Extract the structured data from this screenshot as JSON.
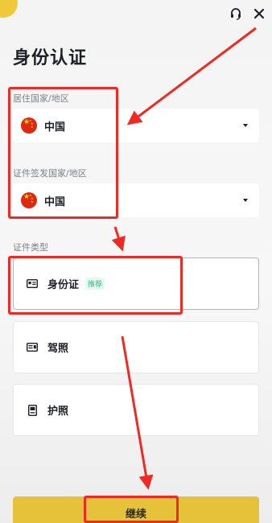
{
  "header": {
    "title": "身份认证",
    "support_icon": "headset-icon",
    "close_icon": "close-icon"
  },
  "residence": {
    "label": "居住国家/地区",
    "value": "中国",
    "flag_icon": "china-flag-icon"
  },
  "issuing": {
    "label": "证件签发国家/地区",
    "value": "中国",
    "flag_icon": "china-flag-icon"
  },
  "document_type": {
    "label": "证件类型",
    "options": [
      {
        "label": "身份证",
        "badge": "推荐",
        "icon": "id-card-icon",
        "selected": true
      },
      {
        "label": "驾照",
        "icon": "driver-license-icon",
        "selected": false
      },
      {
        "label": "护照",
        "icon": "passport-icon",
        "selected": false
      }
    ]
  },
  "footer": {
    "continue_label": "继续"
  },
  "colors": {
    "accent": "#E6C23A",
    "annotation_red": "#EE2A24",
    "badge_green": "#2EBD85",
    "flag_red": "#DE2910"
  }
}
